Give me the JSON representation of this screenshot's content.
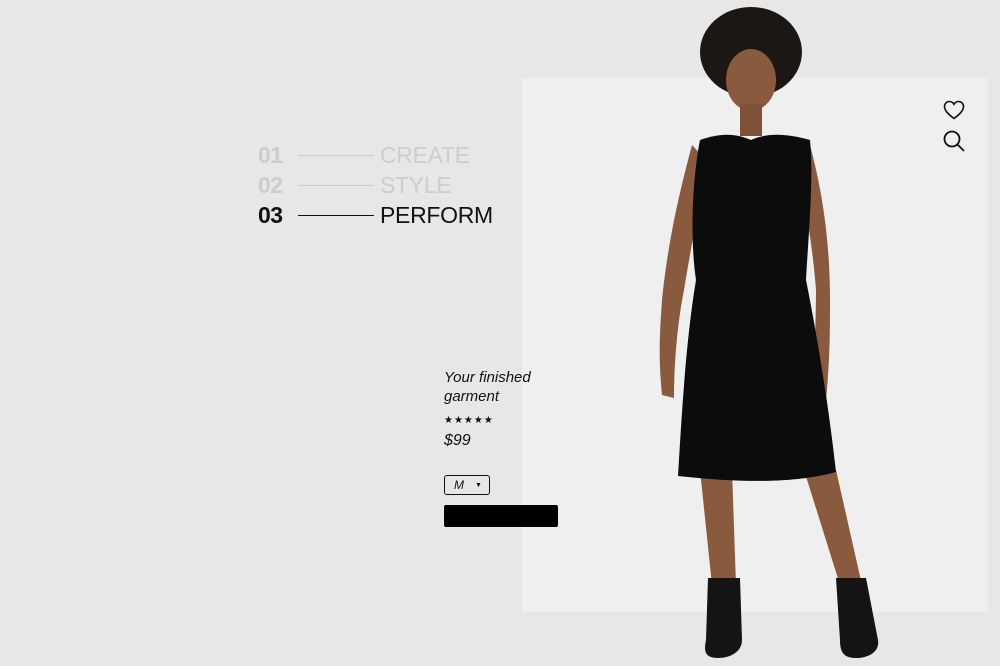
{
  "steps": [
    {
      "number": "01",
      "label": "CREATE",
      "active": false
    },
    {
      "number": "02",
      "label": "STYLE",
      "active": false
    },
    {
      "number": "03",
      "label": "PERFORM",
      "active": true
    }
  ],
  "product": {
    "title": "Your finished garment",
    "rating": "★★★★★",
    "rating_value": 5,
    "price": "$99",
    "size": "M",
    "add_button_label": ""
  },
  "icons": {
    "favorite": "heart-icon",
    "search": "search-icon"
  },
  "colors": {
    "background": "#e7e7e7",
    "photo_panel": "#efefef",
    "active_text": "#111111",
    "inactive_text": "#cdcdcd",
    "button": "#000000"
  }
}
